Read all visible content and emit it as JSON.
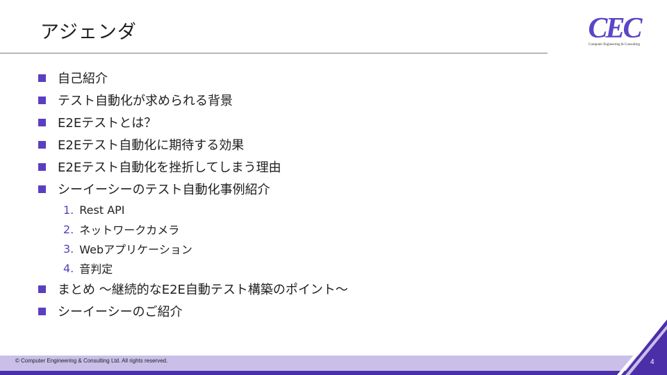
{
  "slide": {
    "title": "アジェンダ",
    "logo": {
      "text": "CEC",
      "tagline": "Computer Engineering & Consulting"
    },
    "agenda_top": [
      "自己紹介",
      "テスト自動化が求められる背景",
      "E2Eテストとは？",
      "E2Eテスト自動化に期待する効果",
      "E2Eテスト自動化を挫折してしまう理由",
      "シーイーシーのテスト自動化事例紹介"
    ],
    "sub_items": [
      {
        "num": "1.",
        "label": "Rest API"
      },
      {
        "num": "2.",
        "label": "ネットワークカメラ"
      },
      {
        "num": "3.",
        "label": "Webアプリケーション"
      },
      {
        "num": "4.",
        "label": "音判定"
      }
    ],
    "agenda_bottom": [
      "まとめ ～継続的なE2E自動テスト構築のポイント～",
      "シーイーシーのご紹介"
    ],
    "footer": "© Computer Engineering & Consulting Ltd. All rights reserved.",
    "page_number": "4"
  },
  "colors": {
    "accent": "#5b3fc0",
    "footer_bar": "#c9bfe9",
    "footer_line": "#4b2fa8"
  }
}
